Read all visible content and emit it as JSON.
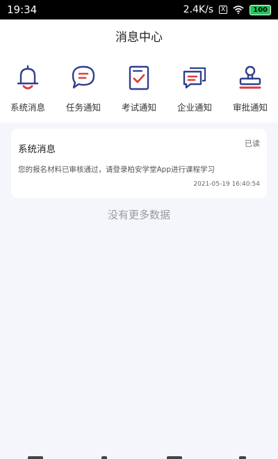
{
  "status_bar": {
    "time": "19:34",
    "network_speed": "2.4K/s",
    "sim_indicator": "X",
    "battery": "100"
  },
  "header": {
    "title": "消息中心"
  },
  "categories": [
    {
      "label": "系统消息",
      "icon": "bell-icon"
    },
    {
      "label": "任务通知",
      "icon": "chat-bubble-icon"
    },
    {
      "label": "考试通知",
      "icon": "exam-checklist-icon"
    },
    {
      "label": "企业通知",
      "icon": "chat-bubbles-icon"
    },
    {
      "label": "审批通知",
      "icon": "approval-stamp-icon"
    }
  ],
  "messages": [
    {
      "title": "系统消息",
      "status": "已读",
      "body": "您的报名材料已审核通过，请登录柏安学堂App进行课程学习",
      "time": "2021-05-19 16:40:54"
    }
  ],
  "empty_note": "没有更多数据",
  "colors": {
    "icon_primary": "#2f3e8c",
    "icon_accent": "#e23a3a",
    "background": "#f4f6fb"
  }
}
